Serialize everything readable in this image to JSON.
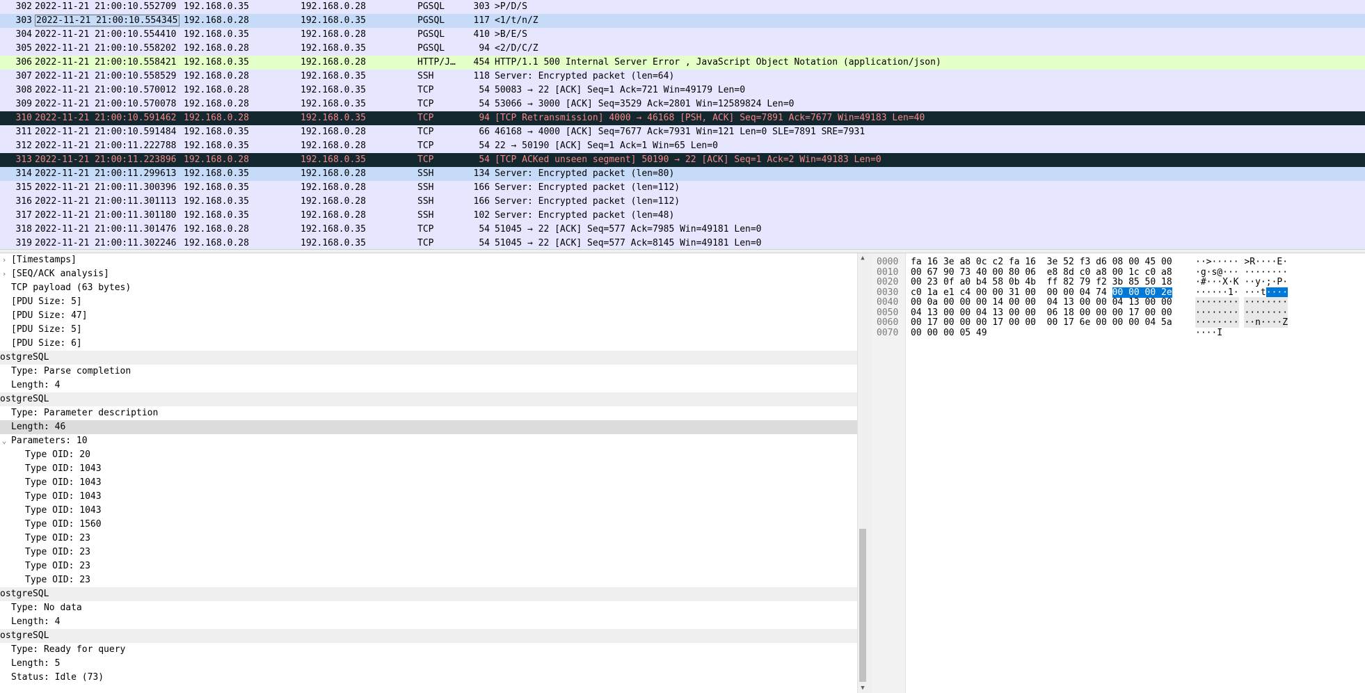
{
  "packets": [
    {
      "no": "302",
      "time": "2022-11-21 21:00:10.552709",
      "src": "192.168.0.35",
      "dst": "192.168.0.28",
      "proto": "PGSQL",
      "len": "303",
      "info": ">P/D/S",
      "style": "pgsql"
    },
    {
      "no": "303",
      "time": "2022-11-21 21:00:10.554345",
      "src": "192.168.0.28",
      "dst": "192.168.0.35",
      "proto": "PGSQL",
      "len": "117",
      "info": "<1/t/n/Z",
      "style": "sel"
    },
    {
      "no": "304",
      "time": "2022-11-21 21:00:10.554410",
      "src": "192.168.0.35",
      "dst": "192.168.0.28",
      "proto": "PGSQL",
      "len": "410",
      "info": ">B/E/S",
      "style": "pgsql"
    },
    {
      "no": "305",
      "time": "2022-11-21 21:00:10.558202",
      "src": "192.168.0.28",
      "dst": "192.168.0.35",
      "proto": "PGSQL",
      "len": "94",
      "info": "<2/D/C/Z",
      "style": "pgsql"
    },
    {
      "no": "306",
      "time": "2022-11-21 21:00:10.558421",
      "src": "192.168.0.35",
      "dst": "192.168.0.28",
      "proto": "HTTP/J…",
      "len": "454",
      "info": "HTTP/1.1 500 Internal Server Error , JavaScript Object Notation (application/json)",
      "style": "http"
    },
    {
      "no": "307",
      "time": "2022-11-21 21:00:10.558529",
      "src": "192.168.0.28",
      "dst": "192.168.0.35",
      "proto": "SSH",
      "len": "118",
      "info": "Server: Encrypted packet (len=64)",
      "style": "ssh"
    },
    {
      "no": "308",
      "time": "2022-11-21 21:00:10.570012",
      "src": "192.168.0.28",
      "dst": "192.168.0.35",
      "proto": "TCP",
      "len": "54",
      "info": "50083 → 22 [ACK] Seq=1 Ack=721 Win=49179 Len=0",
      "style": "tcp"
    },
    {
      "no": "309",
      "time": "2022-11-21 21:00:10.570078",
      "src": "192.168.0.28",
      "dst": "192.168.0.35",
      "proto": "TCP",
      "len": "54",
      "info": "53066 → 3000 [ACK] Seq=3529 Ack=2801 Win=12589824 Len=0",
      "style": "tcp"
    },
    {
      "no": "310",
      "time": "2022-11-21 21:00:10.591462",
      "src": "192.168.0.28",
      "dst": "192.168.0.35",
      "proto": "TCP",
      "len": "94",
      "info": "[TCP Retransmission] 4000 → 46168 [PSH, ACK] Seq=7891 Ack=7677 Win=49183 Len=40",
      "style": "bad"
    },
    {
      "no": "311",
      "time": "2022-11-21 21:00:10.591484",
      "src": "192.168.0.35",
      "dst": "192.168.0.28",
      "proto": "TCP",
      "len": "66",
      "info": "46168 → 4000 [ACK] Seq=7677 Ack=7931 Win=121 Len=0 SLE=7891 SRE=7931",
      "style": "tcp"
    },
    {
      "no": "312",
      "time": "2022-11-21 21:00:11.222788",
      "src": "192.168.0.35",
      "dst": "192.168.0.28",
      "proto": "TCP",
      "len": "54",
      "info": "22 → 50190 [ACK] Seq=1 Ack=1 Win=65 Len=0",
      "style": "tcp"
    },
    {
      "no": "313",
      "time": "2022-11-21 21:00:11.223896",
      "src": "192.168.0.28",
      "dst": "192.168.0.35",
      "proto": "TCP",
      "len": "54",
      "info": "[TCP ACKed unseen segment] 50190 → 22 [ACK] Seq=1 Ack=2 Win=49183 Len=0",
      "style": "bad"
    },
    {
      "no": "314",
      "time": "2022-11-21 21:00:11.299613",
      "src": "192.168.0.35",
      "dst": "192.168.0.28",
      "proto": "SSH",
      "len": "134",
      "info": "Server: Encrypted packet (len=80)",
      "style": "sel"
    },
    {
      "no": "315",
      "time": "2022-11-21 21:00:11.300396",
      "src": "192.168.0.35",
      "dst": "192.168.0.28",
      "proto": "SSH",
      "len": "166",
      "info": "Server: Encrypted packet (len=112)",
      "style": "ssh"
    },
    {
      "no": "316",
      "time": "2022-11-21 21:00:11.301113",
      "src": "192.168.0.35",
      "dst": "192.168.0.28",
      "proto": "SSH",
      "len": "166",
      "info": "Server: Encrypted packet (len=112)",
      "style": "ssh"
    },
    {
      "no": "317",
      "time": "2022-11-21 21:00:11.301180",
      "src": "192.168.0.35",
      "dst": "192.168.0.28",
      "proto": "SSH",
      "len": "102",
      "info": "Server: Encrypted packet (len=48)",
      "style": "ssh"
    },
    {
      "no": "318",
      "time": "2022-11-21 21:00:11.301476",
      "src": "192.168.0.28",
      "dst": "192.168.0.35",
      "proto": "TCP",
      "len": "54",
      "info": "51045 → 22 [ACK] Seq=577 Ack=7985 Win=49181 Len=0",
      "style": "tcp"
    },
    {
      "no": "319",
      "time": "2022-11-21 21:00:11.302246",
      "src": "192.168.0.28",
      "dst": "192.168.0.35",
      "proto": "TCP",
      "len": "54",
      "info": "51045 → 22 [ACK] Seq=577 Ack=8145 Win=49181 Len=0",
      "style": "tcp"
    }
  ],
  "details": [
    {
      "text": "[Timestamps]",
      "indent": 1,
      "arrow": "›",
      "shade": false
    },
    {
      "text": "[SEQ/ACK analysis]",
      "indent": 1,
      "arrow": "›",
      "shade": false
    },
    {
      "text": "TCP payload (63 bytes)",
      "indent": 1,
      "arrow": "",
      "shade": false
    },
    {
      "text": "[PDU Size: 5]",
      "indent": 1,
      "arrow": "",
      "shade": false
    },
    {
      "text": "[PDU Size: 47]",
      "indent": 1,
      "arrow": "",
      "shade": false
    },
    {
      "text": "[PDU Size: 5]",
      "indent": 1,
      "arrow": "",
      "shade": false
    },
    {
      "text": "[PDU Size: 6]",
      "indent": 1,
      "arrow": "",
      "shade": false
    },
    {
      "text": "ostgreSQL",
      "indent": 0,
      "arrow": "",
      "shade": true
    },
    {
      "text": "Type: Parse completion",
      "indent": 1,
      "arrow": "",
      "shade": false
    },
    {
      "text": "Length: 4",
      "indent": 1,
      "arrow": "",
      "shade": false
    },
    {
      "text": "ostgreSQL",
      "indent": 0,
      "arrow": "",
      "shade": true
    },
    {
      "text": "Type: Parameter description",
      "indent": 1,
      "arrow": "",
      "shade": false
    },
    {
      "text": "Length: 46",
      "indent": 1,
      "arrow": "",
      "shade": false,
      "hl": true
    },
    {
      "text": "Parameters: 10",
      "indent": 1,
      "arrow": "⌄",
      "shade": false
    },
    {
      "text": "Type OID: 20",
      "indent": 2,
      "arrow": "",
      "shade": false
    },
    {
      "text": "Type OID: 1043",
      "indent": 2,
      "arrow": "",
      "shade": false
    },
    {
      "text": "Type OID: 1043",
      "indent": 2,
      "arrow": "",
      "shade": false
    },
    {
      "text": "Type OID: 1043",
      "indent": 2,
      "arrow": "",
      "shade": false
    },
    {
      "text": "Type OID: 1043",
      "indent": 2,
      "arrow": "",
      "shade": false
    },
    {
      "text": "Type OID: 1560",
      "indent": 2,
      "arrow": "",
      "shade": false
    },
    {
      "text": "Type OID: 23",
      "indent": 2,
      "arrow": "",
      "shade": false
    },
    {
      "text": "Type OID: 23",
      "indent": 2,
      "arrow": "",
      "shade": false
    },
    {
      "text": "Type OID: 23",
      "indent": 2,
      "arrow": "",
      "shade": false
    },
    {
      "text": "Type OID: 23",
      "indent": 2,
      "arrow": "",
      "shade": false
    },
    {
      "text": "ostgreSQL",
      "indent": 0,
      "arrow": "",
      "shade": true
    },
    {
      "text": "Type: No data",
      "indent": 1,
      "arrow": "",
      "shade": false
    },
    {
      "text": "Length: 4",
      "indent": 1,
      "arrow": "",
      "shade": false
    },
    {
      "text": "ostgreSQL",
      "indent": 0,
      "arrow": "",
      "shade": true
    },
    {
      "text": "Type: Ready for query",
      "indent": 1,
      "arrow": "",
      "shade": false
    },
    {
      "text": "Length: 5",
      "indent": 1,
      "arrow": "",
      "shade": false
    },
    {
      "text": "Status: Idle (73)",
      "indent": 1,
      "arrow": "",
      "shade": false
    }
  ],
  "bytes": [
    {
      "offset": "0000",
      "hex_a": "fa 16 3e a8 0c c2 fa 16",
      "hex_b": "3e 52 f3 d6 08 00 45 00",
      "hex_b_sel": "",
      "ascii_a": "··>·····",
      "ascii_b": ">R····E·",
      "ascii_b_sel": "",
      "shade": false
    },
    {
      "offset": "0010",
      "hex_a": "00 67 90 73 40 00 80 06",
      "hex_b": "e8 8d c0 a8 00 1c c0 a8",
      "hex_b_sel": "",
      "ascii_a": "·g·s@···",
      "ascii_b": "········",
      "ascii_b_sel": "",
      "shade": false
    },
    {
      "offset": "0020",
      "hex_a": "00 23 0f a0 b4 58 0b 4b",
      "hex_b": "ff 82 79 f2 3b 85 50 18",
      "hex_b_sel": "",
      "ascii_a": "·#···X·K",
      "ascii_b": "··y·;·P·",
      "ascii_b_sel": "",
      "shade": false
    },
    {
      "offset": "0030",
      "hex_a": "c0 1a e1 c4 00 00 31 00",
      "hex_b": "00 00 04 74 ",
      "hex_b_sel": "00 00 00 2e",
      "ascii_a": "······1·",
      "ascii_b": "···t",
      "ascii_b_sel": "····",
      "shade": false
    },
    {
      "offset": "0040",
      "hex_a": "00 0a 00 00 00 14 00 00",
      "hex_b": "04 13 00 00 04 13 00 00",
      "hex_b_sel": "",
      "ascii_a": "········",
      "ascii_b": "········",
      "ascii_b_sel": "",
      "shade": true
    },
    {
      "offset": "0050",
      "hex_a": "04 13 00 00 04 13 00 00",
      "hex_b": "06 18 00 00 00 17 00 00",
      "hex_b_sel": "",
      "ascii_a": "········",
      "ascii_b": "········",
      "ascii_b_sel": "",
      "shade": true
    },
    {
      "offset": "0060",
      "hex_a": "00 17 00 00 00 17 00 00",
      "hex_b": "00 17 6e 00 00 00 04 5a",
      "hex_b_sel": "",
      "ascii_a": "········",
      "ascii_b": "··n····Z",
      "ascii_b_sel": "",
      "shade": true
    },
    {
      "offset": "0070",
      "hex_a": "00 00 00 05 49",
      "hex_b": "",
      "hex_b_sel": "",
      "ascii_a": "····I",
      "ascii_b": "",
      "ascii_b_sel": "",
      "shade": false
    }
  ],
  "scrollbar": {
    "up_icon": "▲",
    "down_icon": "▼"
  }
}
